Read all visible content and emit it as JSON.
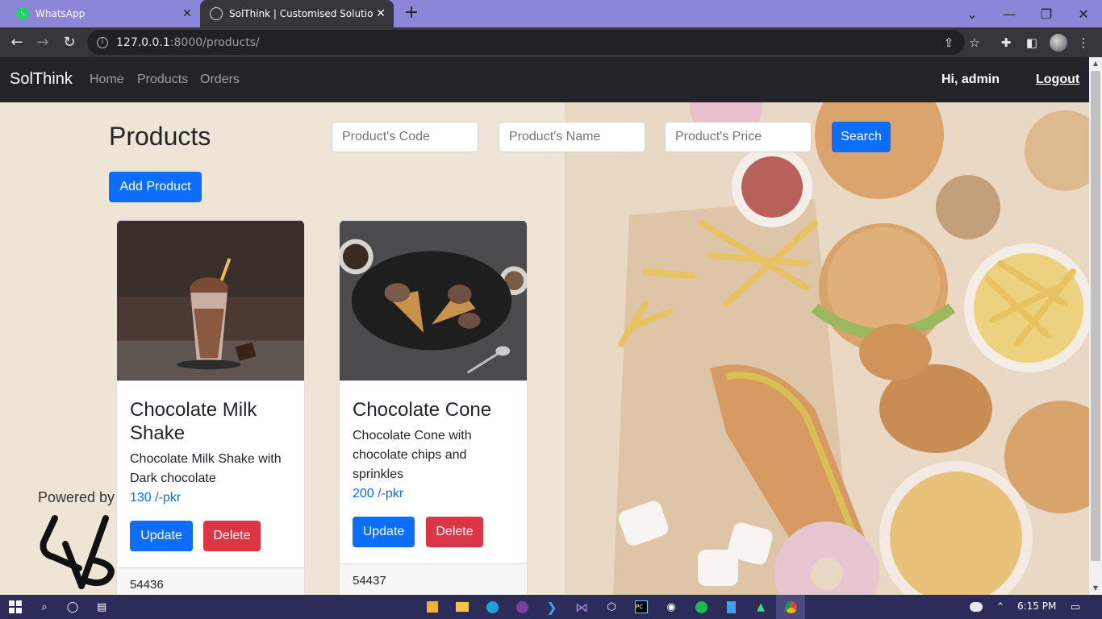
{
  "browser": {
    "tabs": [
      {
        "title": "WhatsApp",
        "icon": "whatsapp-icon",
        "active": false
      },
      {
        "title": "SolThink | Customised Solutions",
        "icon": "globe-icon",
        "active": true
      }
    ],
    "url_host": "127.0.0.1",
    "url_path": ":8000/products/"
  },
  "navbar": {
    "brand": "SolThink",
    "links": [
      "Home",
      "Products",
      "Orders"
    ],
    "greeting": "Hi, admin",
    "logout": "Logout"
  },
  "page": {
    "title": "Products",
    "search": {
      "code_placeholder": "Product's Code",
      "name_placeholder": "Product's Name",
      "price_placeholder": "Product's Price",
      "button": "Search"
    },
    "add_button": "Add Product",
    "powered_by": "Powered by"
  },
  "products": [
    {
      "name": "Chocolate Milk Shake",
      "description": "Chocolate Milk Shake with Dark chocolate",
      "price": "130 /-pkr",
      "code": "54436",
      "update": "Update",
      "delete": "Delete"
    },
    {
      "name": "Chocolate Cone",
      "description": "Chocolate Cone with chocolate chips and sprinkles",
      "price": "200 /-pkr",
      "code": "54437",
      "update": "Update",
      "delete": "Delete"
    }
  ],
  "taskbar": {
    "time": "6:15 PM"
  },
  "colors": {
    "primary": "#0d6efd",
    "danger": "#dc3545",
    "navbar": "#212529",
    "tabbar": "#8b86d8"
  }
}
